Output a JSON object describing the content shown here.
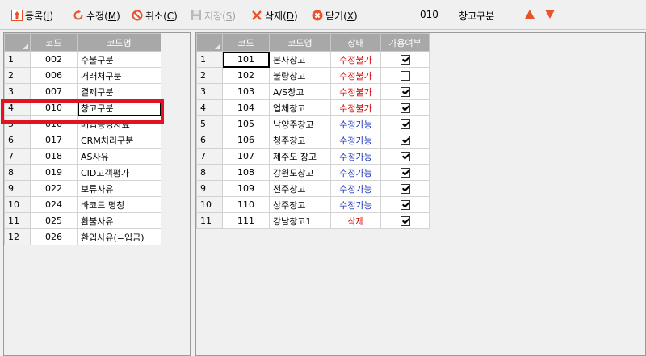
{
  "toolbar": {
    "register": "등록",
    "register_key": "I",
    "edit": "수정",
    "edit_key": "M",
    "cancel": "취소",
    "cancel_key": "C",
    "save": "저장",
    "save_key": "S",
    "delete": "삭제",
    "delete_key": "D",
    "close": "닫기",
    "close_key": "X",
    "current_code": "010",
    "current_name": "창고구분"
  },
  "left_grid": {
    "headers": [
      "코드",
      "코드명"
    ],
    "rows": [
      {
        "no": "1",
        "code": "002",
        "name": "수불구분"
      },
      {
        "no": "2",
        "code": "006",
        "name": "거래처구분"
      },
      {
        "no": "3",
        "code": "007",
        "name": "결제구분"
      },
      {
        "no": "4",
        "code": "010",
        "name": "창고구분"
      },
      {
        "no": "5",
        "code": "016",
        "name": "매입증빙자료"
      },
      {
        "no": "6",
        "code": "017",
        "name": "CRM처리구분"
      },
      {
        "no": "7",
        "code": "018",
        "name": "AS사유"
      },
      {
        "no": "8",
        "code": "019",
        "name": "CID고객평가"
      },
      {
        "no": "9",
        "code": "022",
        "name": "보류사유"
      },
      {
        "no": "10",
        "code": "024",
        "name": "바코드 명칭"
      },
      {
        "no": "11",
        "code": "025",
        "name": "환불사유"
      },
      {
        "no": "12",
        "code": "026",
        "name": "환입사유(=입금)"
      }
    ]
  },
  "right_grid": {
    "headers": [
      "코드",
      "코드명",
      "상태",
      "가용여부"
    ],
    "rows": [
      {
        "no": "1",
        "code": "101",
        "name": "본사창고",
        "status": "수정불가",
        "status_type": "locked",
        "available": true
      },
      {
        "no": "2",
        "code": "102",
        "name": "불량창고",
        "status": "수정불가",
        "status_type": "locked",
        "available": false
      },
      {
        "no": "3",
        "code": "103",
        "name": "A/S창고",
        "status": "수정불가",
        "status_type": "locked",
        "available": true
      },
      {
        "no": "4",
        "code": "104",
        "name": "업체창고",
        "status": "수정불가",
        "status_type": "locked",
        "available": true
      },
      {
        "no": "5",
        "code": "105",
        "name": "남양주창고",
        "status": "수정가능",
        "status_type": "editable",
        "available": true
      },
      {
        "no": "6",
        "code": "106",
        "name": "청주창고",
        "status": "수정가능",
        "status_type": "editable",
        "available": true
      },
      {
        "no": "7",
        "code": "107",
        "name": "제주도 창고",
        "status": "수정가능",
        "status_type": "editable",
        "available": true
      },
      {
        "no": "8",
        "code": "108",
        "name": "강원도창고",
        "status": "수정가능",
        "status_type": "editable",
        "available": true
      },
      {
        "no": "9",
        "code": "109",
        "name": "전주창고",
        "status": "수정가능",
        "status_type": "editable",
        "available": true
      },
      {
        "no": "10",
        "code": "110",
        "name": "상주창고",
        "status": "수정가능",
        "status_type": "editable",
        "available": true
      },
      {
        "no": "11",
        "code": "111",
        "name": "강남창고1",
        "status": "삭제",
        "status_type": "deleted",
        "available": true
      }
    ]
  },
  "colors": {
    "accent": "#e8532b",
    "highlight": "#e0141e",
    "status_locked": "#d40000",
    "status_editable": "#1a32b8"
  }
}
